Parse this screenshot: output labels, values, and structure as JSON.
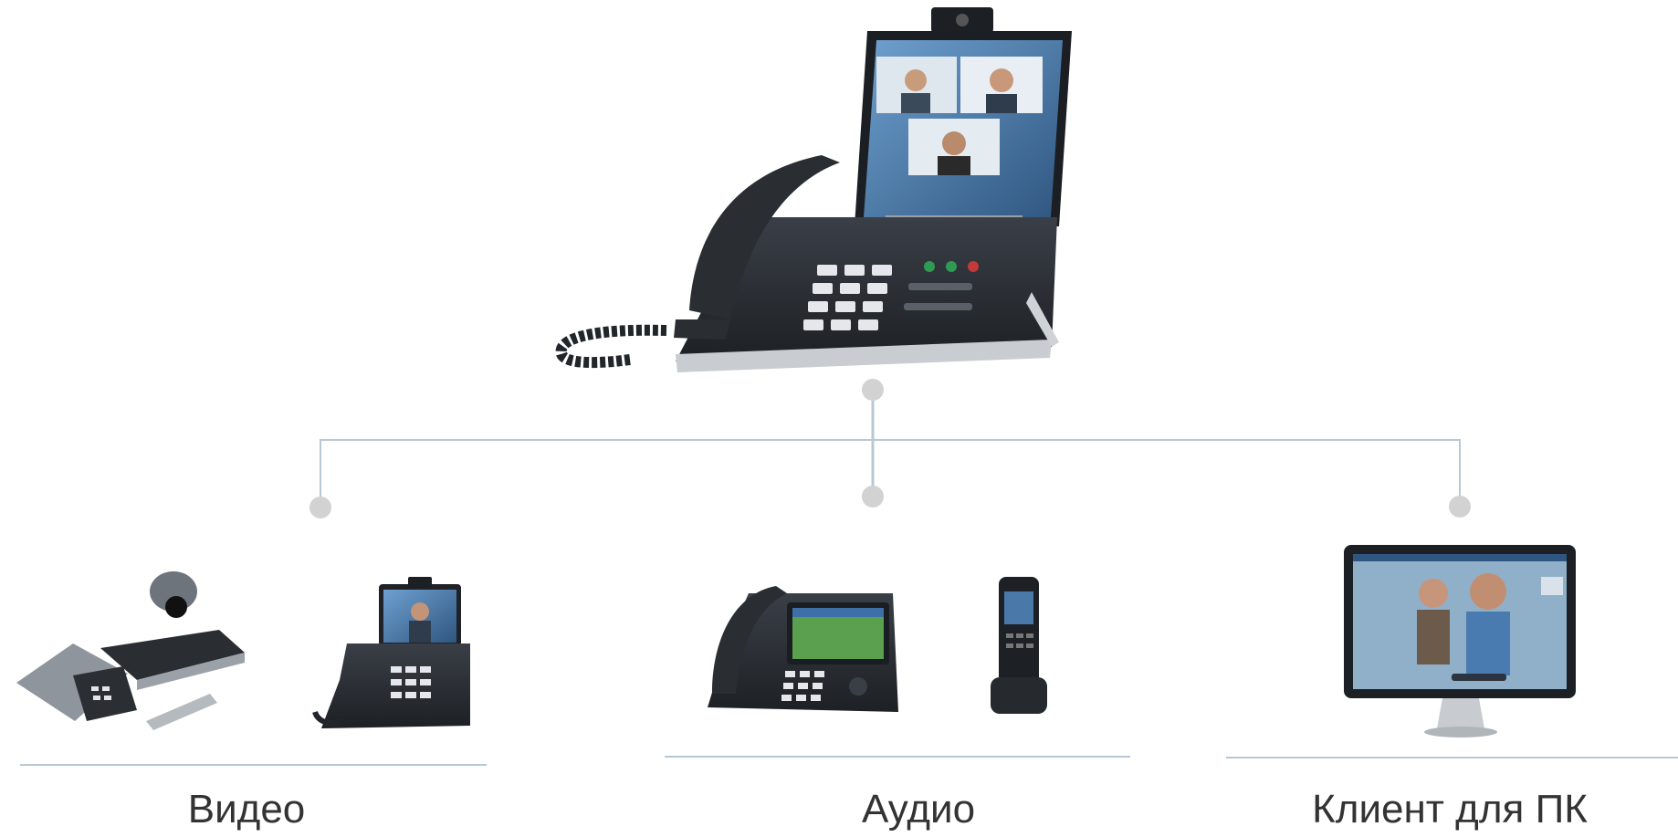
{
  "colors": {
    "connector": "#b8c7d6",
    "node": "#d2d2d2",
    "device_dark": "#2b2f35",
    "screen": "#4a78a8"
  },
  "categories": [
    {
      "label": "Видео",
      "icons": [
        "conference-system-icon",
        "video-desk-phone-icon"
      ]
    },
    {
      "label": "Аудио",
      "icons": [
        "ip-desk-phone-icon",
        "dect-handset-icon"
      ]
    },
    {
      "label": "Клиент для ПК",
      "icons": [
        "pc-monitor-icon"
      ]
    }
  ],
  "hub": {
    "icon": "video-phone-hub-icon"
  }
}
